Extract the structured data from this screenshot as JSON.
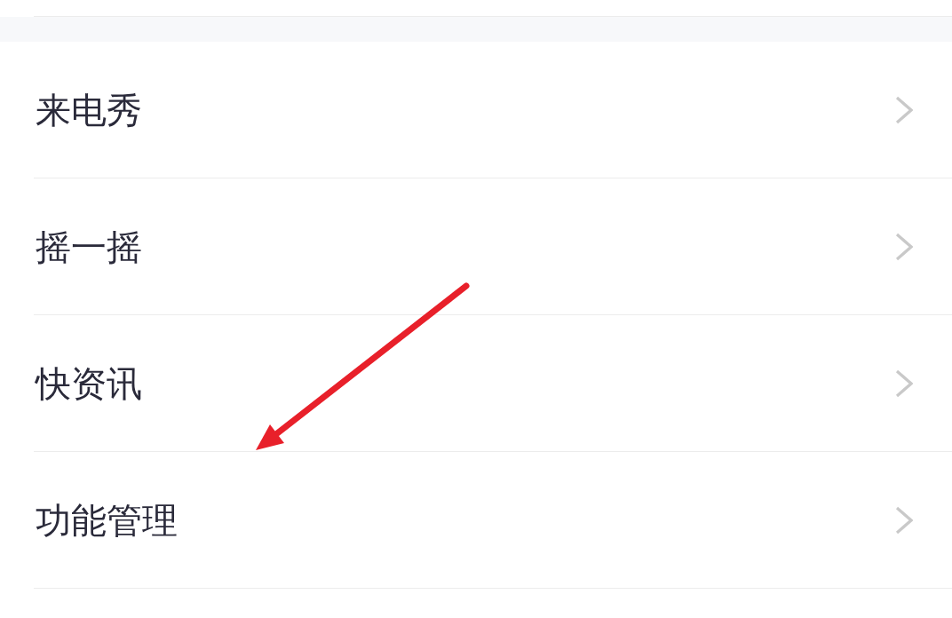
{
  "menu_items": [
    {
      "label": "来电秀"
    },
    {
      "label": "摇一摇"
    },
    {
      "label": "快资讯"
    },
    {
      "label": "功能管理"
    }
  ],
  "annotation": {
    "kind": "arrow"
  }
}
